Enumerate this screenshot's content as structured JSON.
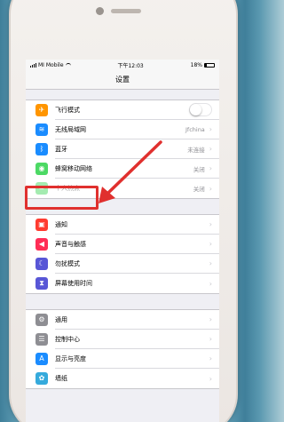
{
  "status_bar": {
    "carrier": "MI Mobile",
    "time": "下午12:03",
    "battery": "18%"
  },
  "nav": {
    "title": "设置"
  },
  "groups": [
    [
      {
        "label": "飞行模式",
        "icon": "airplane-icon",
        "color": "#ff9500",
        "value": "",
        "control": "toggle-off"
      },
      {
        "label": "无线局域网",
        "icon": "wifi-icon",
        "color": "#1a8cff",
        "value": "Jfchina"
      },
      {
        "label": "蓝牙",
        "icon": "bluetooth-icon",
        "color": "#1a8cff",
        "value": "未连接"
      },
      {
        "label": "蜂窝移动网络",
        "icon": "cellular-icon",
        "color": "#4cd964",
        "value": "关闭"
      },
      {
        "label": "个人热点",
        "icon": "hotspot-icon",
        "color": "#4cd964",
        "value": "关闭",
        "disabled": true
      }
    ],
    [
      {
        "label": "通知",
        "icon": "notifications-icon",
        "color": "#ff3b30",
        "value": ""
      },
      {
        "label": "声音与触感",
        "icon": "sounds-icon",
        "color": "#ff2d55",
        "value": ""
      },
      {
        "label": "勿扰模式",
        "icon": "moon-icon",
        "color": "#5856d6",
        "value": ""
      },
      {
        "label": "屏幕使用时间",
        "icon": "hourglass-icon",
        "color": "#5856d6",
        "value": ""
      }
    ],
    [
      {
        "label": "通用",
        "icon": "gear-icon",
        "color": "#8e8e93",
        "value": ""
      },
      {
        "label": "控制中心",
        "icon": "control-center-icon",
        "color": "#8e8e93",
        "value": ""
      },
      {
        "label": "显示与亮度",
        "icon": "display-icon",
        "color": "#1a8cff",
        "value": ""
      },
      {
        "label": "墙纸",
        "icon": "wallpaper-icon",
        "color": "#35aadc",
        "value": ""
      }
    ]
  ],
  "annotation": {
    "color": "#e0302e"
  }
}
